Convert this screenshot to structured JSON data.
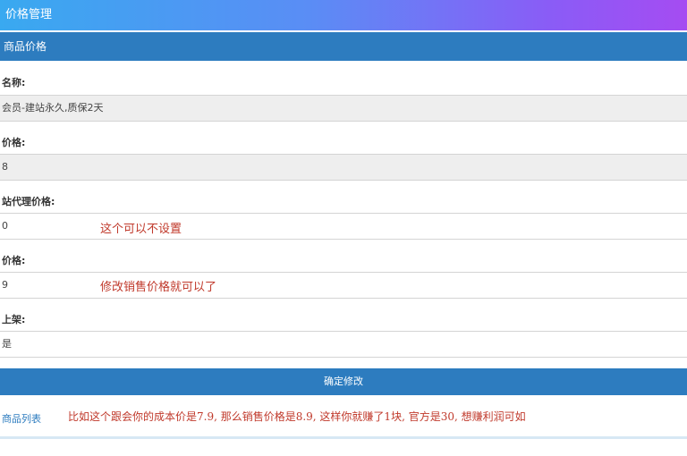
{
  "header": {
    "title": "价格管理"
  },
  "panel": {
    "title": "商品价格"
  },
  "form": {
    "name_label": "名称:",
    "name_value": "会员-建站永久,质保2天",
    "cost_label": "价格:",
    "cost_value": "8",
    "agent_label": "站代理价格:",
    "agent_value": "0",
    "sale_label": "价格:",
    "sale_value": "9",
    "shelf_label": "上架:",
    "shelf_value": "是",
    "submit_label": "确定修改"
  },
  "annotations": {
    "agent_note": "这个可以不设置",
    "sale_note": "修改销售价格就可以了",
    "bottom_note": "比如这个跟会你的成本价是7.9, 那么销售价格是8.9, 这样你就赚了1块, 官方是30, 想赚利润可如"
  },
  "footer": {
    "back_link": "商品列表"
  }
}
